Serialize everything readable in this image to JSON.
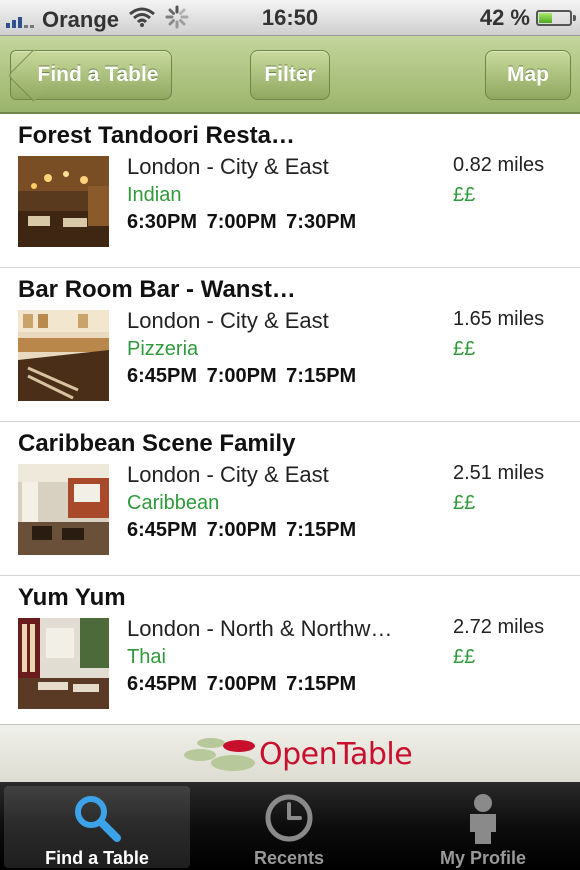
{
  "status_bar": {
    "carrier": "Orange",
    "time": "16:50",
    "battery": "42 %",
    "battery_level": 0.42
  },
  "nav": {
    "back_label": "Find a Table",
    "filter_label": "Filter",
    "map_label": "Map"
  },
  "colors": {
    "accent_green": "#2f9a3a",
    "nav_green": "#9bb46c",
    "brand_red": "#c8102e"
  },
  "restaurants": [
    {
      "name": "Forest Tandoori Resta…",
      "area": "London - City & East",
      "cuisine": "Indian",
      "times": "6:30PM 7:00PM 7:30PM",
      "distance": "0.82 miles",
      "price": "££"
    },
    {
      "name": "Bar Room Bar - Wanst…",
      "area": "London - City & East",
      "cuisine": "Pizzeria",
      "times": "6:45PM 7:00PM 7:15PM",
      "distance": "1.65 miles",
      "price": "££"
    },
    {
      "name": "Caribbean Scene Family",
      "area": "London - City & East",
      "cuisine": "Caribbean",
      "times": "6:45PM 7:00PM 7:15PM",
      "distance": "2.51 miles",
      "price": "££"
    },
    {
      "name": "Yum Yum",
      "area": "London - North & Northw…",
      "cuisine": "Thai",
      "times": "6:45PM 7:00PM 7:15PM",
      "distance": "2.72 miles",
      "price": "££"
    }
  ],
  "logo": {
    "text": "OpenTable"
  },
  "tabs": [
    {
      "label": "Find a Table",
      "icon": "search-icon",
      "active": true
    },
    {
      "label": "Recents",
      "icon": "clock-icon",
      "active": false
    },
    {
      "label": "My Profile",
      "icon": "person-icon",
      "active": false
    }
  ]
}
